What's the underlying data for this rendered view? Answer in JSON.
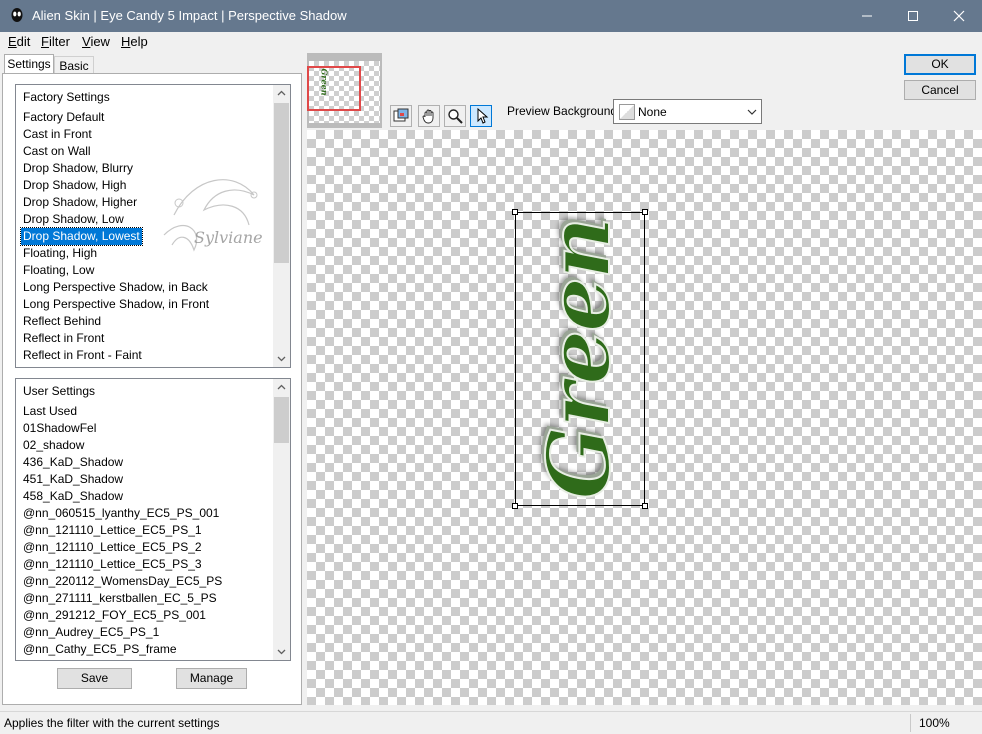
{
  "window": {
    "title": "Alien Skin | Eye Candy 5 Impact | Perspective Shadow"
  },
  "menu": [
    {
      "label": "Edit",
      "accel": "E",
      "rest": "dit"
    },
    {
      "label": "Filter",
      "accel": "F",
      "rest": "ilter"
    },
    {
      "label": "View",
      "accel": "V",
      "rest": "iew"
    },
    {
      "label": "Help",
      "accel": "H",
      "rest": "elp"
    }
  ],
  "tabs": {
    "settings": "Settings",
    "basic": "Basic"
  },
  "factory_settings": {
    "header": "Factory Settings",
    "items": [
      "Factory Default",
      "Cast in Front",
      "Cast on Wall",
      "Drop Shadow, Blurry",
      "Drop Shadow, High",
      "Drop Shadow, Higher",
      "Drop Shadow, Low",
      "Drop Shadow, Lowest",
      "Floating, High",
      "Floating, Low",
      "Long Perspective Shadow, in Back",
      "Long Perspective Shadow, in Front",
      "Reflect Behind",
      "Reflect in Front",
      "Reflect in Front - Faint"
    ],
    "selected": "Drop Shadow, Lowest"
  },
  "user_settings": {
    "header": "User Settings",
    "items": [
      "Last Used",
      "01ShadowFel",
      "02_shadow",
      "436_KaD_Shadow",
      "451_KaD_Shadow",
      "458_KaD_Shadow",
      "@nn_060515_lyanthy_EC5_PS_001",
      "@nn_121110_Lettice_EC5_PS_1",
      "@nn_121110_Lettice_EC5_PS_2",
      "@nn_121110_Lettice_EC5_PS_3",
      "@nn_220112_WomensDay_EC5_PS",
      "@nn_271111_kerstballen_EC_5_PS",
      "@nn_291212_FOY_EC5_PS_001",
      "@nn_Audrey_EC5_PS_1",
      "@nn_Cathy_EC5_PS_frame"
    ]
  },
  "buttons": {
    "save": "Save",
    "manage": "Manage",
    "ok": "OK",
    "cancel": "Cancel"
  },
  "preview": {
    "background_label": "Preview Background:",
    "background_value": "None",
    "text": "Green",
    "thumb_text": "Green",
    "watermark": "Sylviane"
  },
  "status": {
    "message": "Applies the filter with the current settings",
    "zoom": "100%"
  },
  "colors": {
    "titlebar": "#65788e",
    "selection": "#0078d7",
    "text_green": "#2f6b1a"
  },
  "icons": {
    "app": "alien-skin-icon",
    "navigator": "navigator-icon",
    "hand": "hand-icon",
    "zoom": "zoom-icon",
    "arrow": "arrow-pointer-icon"
  }
}
